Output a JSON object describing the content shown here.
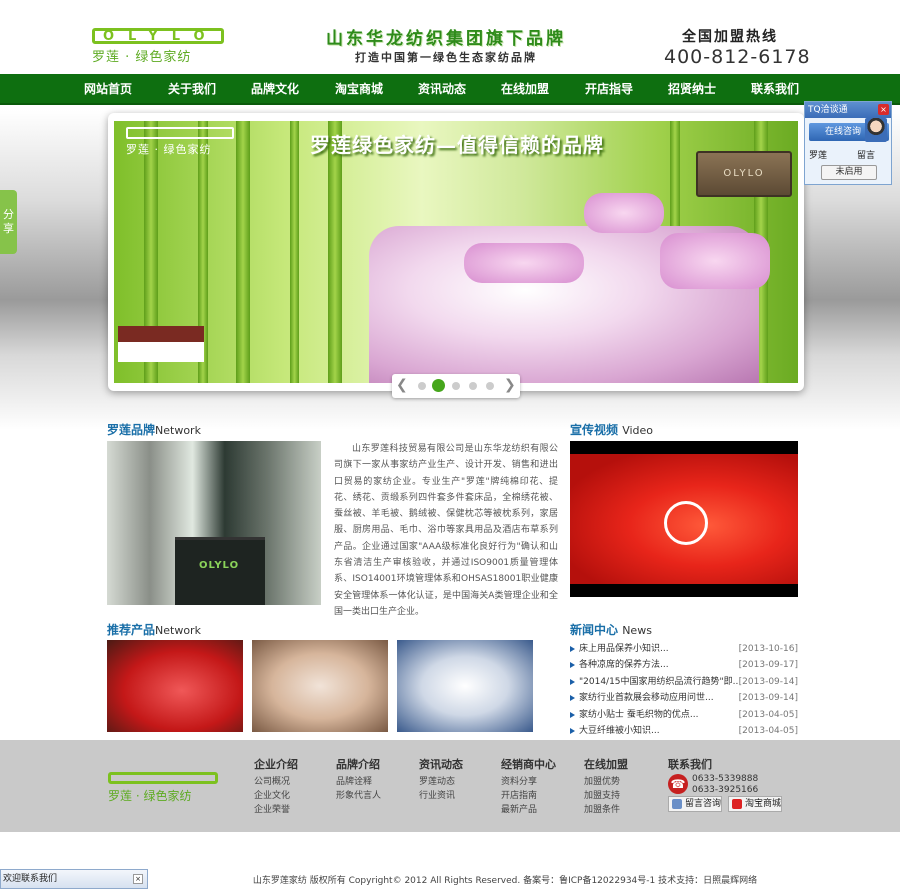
{
  "header": {
    "logo_text": "OLYLO",
    "logo_sub": "罗莲 · 绿色家纺",
    "slogan_main": "山东华龙纺织集团旗下品牌",
    "slogan_sub": "打造中国第一绿色生态家纺品牌",
    "hotline_label": "全国加盟热线",
    "hotline_number": "400-812-6178"
  },
  "nav": {
    "items": [
      "网站首页",
      "关于我们",
      "品牌文化",
      "淘宝商城",
      "资讯动态",
      "在线加盟",
      "开店指导",
      "招贤纳士",
      "联系我们"
    ]
  },
  "banner": {
    "logo_sub": "罗莲 · 绿色家纺",
    "title": "罗莲绿色家纺—值得信赖的品牌",
    "sign_text": "OLYLO",
    "slide_count": 5,
    "active_slide": 2
  },
  "share_tab": {
    "label": "分享"
  },
  "tq_panel": {
    "title": "TQ洽谈通",
    "online_label": "在线咨询",
    "user_name": "罗莲",
    "message_label": "留言",
    "status_button": "未启用"
  },
  "brand_section": {
    "title": "罗莲品牌",
    "title_en": "Network",
    "store_sign": "OLYLO",
    "description": "山东罗莲科技贸易有限公司是山东华龙纺织有限公司旗下一家从事家纺产业生产、设计开发、销售和进出口贸易的家纺企业。专业生产\"罗莲\"牌纯棉印花、提花、绣花、贡缎系列四件套多件套床品，全棉绣花被、蚕丝被、羊毛被、鹅绒被、保健枕芯等被枕系列，家居服、厨房用品、毛巾、浴巾等家具用品及酒店布草系列产品。企业通过国家\"AAA级标准化良好行为\"确认和山东省清洁生产审核验收，并通过ISO9001质量管理体系、ISO14001环境管理体系和OHSAS18001职业健康安全管理体系一体化认证，是中国海关A类管理企业和全国一类出口生产企业。"
  },
  "video_section": {
    "title": "宣传视频",
    "title_en": "Video"
  },
  "products_section": {
    "title": "推荐产品",
    "title_en": "Network"
  },
  "news_section": {
    "title": "新闻中心",
    "title_en": "News",
    "items": [
      {
        "title": "床上用品保养小知识...",
        "date": "[2013-10-16]"
      },
      {
        "title": "各种凉席的保养方法...",
        "date": "[2013-09-17]"
      },
      {
        "title": "\"2014/15中国家用纺织品流行趋势\"即...",
        "date": "[2013-09-14]"
      },
      {
        "title": "家纺行业首款展会移动应用问世...",
        "date": "[2013-09-14]"
      },
      {
        "title": "家纺小贴士 蚕毛织物的优点...",
        "date": "[2013-04-05]"
      },
      {
        "title": "大豆纤维被小知识...",
        "date": "[2013-04-05]"
      }
    ]
  },
  "footer": {
    "logo_text": "OLYLO",
    "logo_sub": "罗莲 · 绿色家纺",
    "columns": [
      {
        "title": "企业介绍",
        "links": [
          "公司概况",
          "企业文化",
          "企业荣誉"
        ]
      },
      {
        "title": "品牌介绍",
        "links": [
          "品牌诠释",
          "形象代言人"
        ]
      },
      {
        "title": "资讯动态",
        "links": [
          "罗莲动态",
          "行业资讯"
        ]
      },
      {
        "title": "经销商中心",
        "links": [
          "资料分享",
          "开店指南",
          "最新产品"
        ]
      },
      {
        "title": "在线加盟",
        "links": [
          "加盟优势",
          "加盟支持",
          "加盟条件"
        ]
      }
    ],
    "contact": {
      "title": "联系我们",
      "phone1": "0633-5339888",
      "phone2": "0633-3925166",
      "message_button": "留言咨询",
      "taobao_button": "淘宝商城"
    }
  },
  "copyright": "山东罗莲家纺   版权所有 Copyright© 2012 All Rights Reserved.  备案号：鲁ICP备12022934号-1   技术支持：日照晨辉网络",
  "welcome_bar": {
    "label": "欢迎联系我们"
  },
  "colors": {
    "nav_green": "#0e6f10",
    "brand_green": "#7cc11f",
    "title_blue": "#1a6fa8"
  }
}
